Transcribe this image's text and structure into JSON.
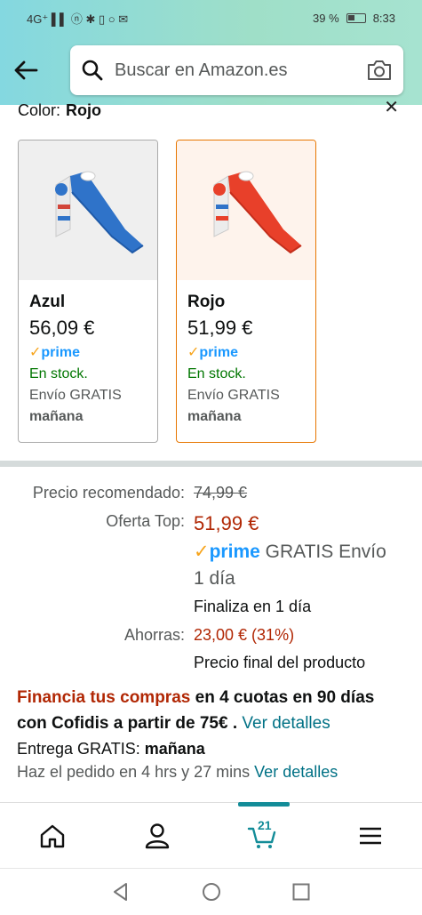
{
  "status_bar": {
    "left": "4G⁺ ▌▌ ⓝ ✱ ▯ ○ ✉",
    "battery_pct": "39 %",
    "time": "8:33"
  },
  "search": {
    "placeholder": "Buscar en Amazon.es"
  },
  "color_selector": {
    "label": "Color:",
    "value": "Rojo",
    "options": [
      {
        "name": "Azul",
        "price": "56,09 €",
        "prime": "prime",
        "stock": "En stock.",
        "shipping": "Envío GRATIS",
        "when": "mañana",
        "slide_color": "#2f73c9",
        "selected": false
      },
      {
        "name": "Rojo",
        "price": "51,99 €",
        "prime": "prime",
        "stock": "En stock.",
        "shipping": "Envío GRATIS",
        "when": "mañana",
        "slide_color": "#e8402a",
        "selected": true
      }
    ]
  },
  "pricing": {
    "list_label": "Precio recomendado:",
    "list_price": "74,99 €",
    "deal_label": "Oferta Top:",
    "deal_price": "51,99 €",
    "prime_text": "prime",
    "prime_shipping_line1": "GRATIS Envío",
    "prime_shipping_line2": "1 día",
    "ends": "Finaliza en 1 día",
    "savings_label": "Ahorras:",
    "savings_value": "23,00 € (31%)",
    "final_note": "Precio final del producto"
  },
  "financing": {
    "highlight": "Financia tus compras",
    "text": " en 4 cuotas en 90 días con Cofidis a partir de 75€",
    "link": "Ver detalles"
  },
  "delivery": {
    "label": "Entrega GRATIS:",
    "day": "mañana",
    "order_text": "Haz el pedido en 4 hrs y 27 mins",
    "link": "Ver detalles"
  },
  "bottom_nav": {
    "cart_count": "21"
  },
  "colors": {
    "accent_teal": "#138c98",
    "prime_blue": "#1a98ff",
    "deal_red": "#b12704",
    "stock_green": "#007600",
    "link": "#007185",
    "selected_border": "#e77600"
  }
}
